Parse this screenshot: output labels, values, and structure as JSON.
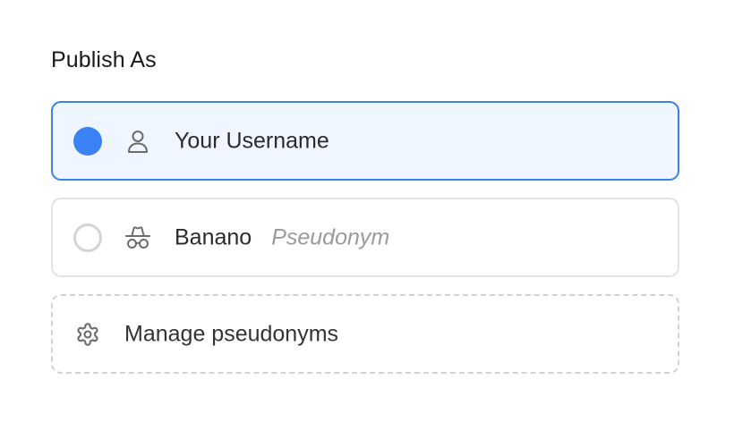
{
  "publish": {
    "title": "Publish As",
    "options": [
      {
        "label": "Your Username",
        "sublabel": "",
        "icon": "user-icon",
        "selected": true
      },
      {
        "label": "Banano",
        "sublabel": "Pseudonym",
        "icon": "incognito-icon",
        "selected": false
      }
    ],
    "manage": {
      "label": "Manage pseudonyms",
      "icon": "gear-icon"
    }
  },
  "colors": {
    "accent": "#3b82f6",
    "selected_bg": "#eff6ff",
    "selected_border": "#3b82e6",
    "border": "#e3e3e3",
    "muted_text": "#9a9a9a"
  }
}
